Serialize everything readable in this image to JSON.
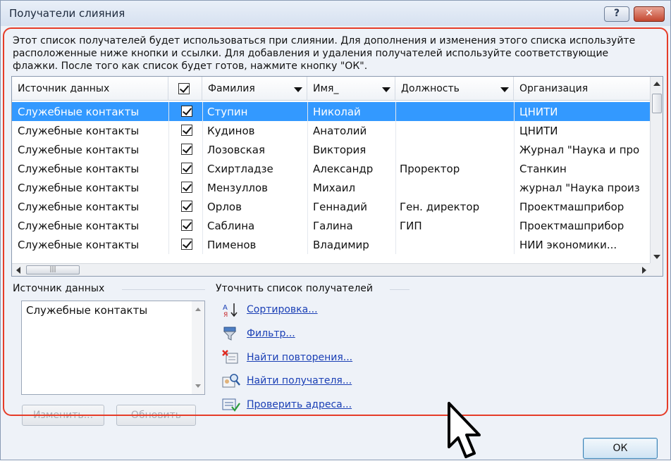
{
  "window": {
    "title": "Получатели слияния",
    "help_label": "?",
    "close_label": "✕"
  },
  "intro": "Этот список получателей будет использоваться при слиянии. Для дополнения и изменения этого списка используйте расположенные ниже кнопки и ссылки. Для добавления и удаления получателей используйте соответствующие флажки. После того как список будет готов, нажмите кнопку \"ОК\".",
  "grid": {
    "columns": [
      "Источник данных",
      "",
      "Фамилия",
      "Имя_",
      "Должность",
      "Организация"
    ],
    "rows": [
      {
        "source": "Служебные контакты",
        "checked": true,
        "last": "Ступин",
        "first": "Николай",
        "position": "",
        "org": "ЦНИТИ",
        "selected": true
      },
      {
        "source": "Служебные контакты",
        "checked": true,
        "last": "Кудинов",
        "first": "Анатолий",
        "position": "",
        "org": "ЦНИТИ"
      },
      {
        "source": "Служебные контакты",
        "checked": true,
        "last": "Лозовская",
        "first": "Виктория",
        "position": "",
        "org": "Журнал \"Наука и про"
      },
      {
        "source": "Служебные контакты",
        "checked": true,
        "last": "Схиртладзе",
        "first": "Александр",
        "position": "Проректор",
        "org": "Станкин"
      },
      {
        "source": "Служебные контакты",
        "checked": true,
        "last": "Мензуллов",
        "first": "Михаил",
        "position": "",
        "org": "журнал \"Наука произ"
      },
      {
        "source": "Служебные контакты",
        "checked": true,
        "last": "Орлов",
        "first": "Геннадий",
        "position": "Ген. директор",
        "org": "Проектмашприбор"
      },
      {
        "source": "Служебные контакты",
        "checked": true,
        "last": "Саблина",
        "first": "Галина",
        "position": "ГИП",
        "org": "Проектмашприбор"
      },
      {
        "source": "Служебные контакты",
        "checked": true,
        "last": "Пименов",
        "first": "Владимир",
        "position": "",
        "org": "НИИ экономики..."
      }
    ]
  },
  "data_source": {
    "label": "Источник данных",
    "items": [
      "Служебные контакты"
    ]
  },
  "refine": {
    "label": "Уточнить список получателей",
    "links": [
      "Сортировка...",
      "Фильтр...",
      "Найти повторения...",
      "Найти получателя...",
      "Проверить адреса..."
    ]
  },
  "buttons": {
    "edit": "Изменить...",
    "refresh": "Обновить",
    "ok": "ОК"
  },
  "colors": {
    "highlight": "#e63c28",
    "selection": "#3399ff",
    "link": "#1a3fb5"
  }
}
